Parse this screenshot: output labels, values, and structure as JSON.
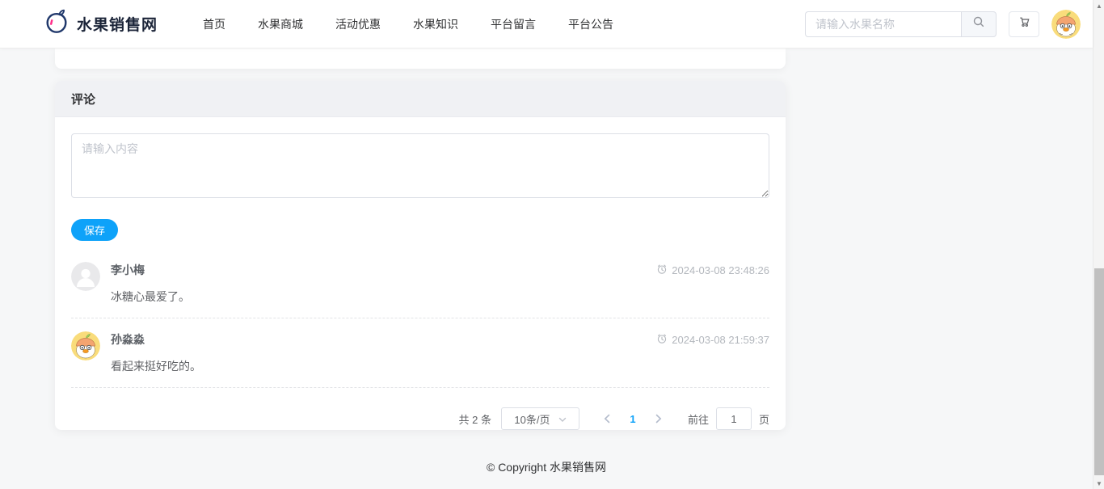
{
  "brand": {
    "name": "水果销售网"
  },
  "nav": {
    "items": [
      {
        "label": "首页"
      },
      {
        "label": "水果商城"
      },
      {
        "label": "活动优惠"
      },
      {
        "label": "水果知识"
      },
      {
        "label": "平台留言"
      },
      {
        "label": "平台公告"
      }
    ]
  },
  "search": {
    "placeholder": "请输入水果名称"
  },
  "icons": {
    "search_icon": "magnifier",
    "cart_icon": "shopping-cart",
    "time_icon": "alarm-clock",
    "select_icon": "chevron-down",
    "prev_icon": "chevron-left",
    "next_icon": "chevron-right",
    "logo_icon": "apple-outline",
    "avatar_icon": "orange-duck-cartoon",
    "default_avatar_icon": "person-silhouette",
    "scroll_up_icon": "▲",
    "scroll_down_icon": "▼"
  },
  "comments_card": {
    "title": "评论",
    "editor": {
      "placeholder": "请输入内容",
      "save_label": "保存"
    },
    "comments": [
      {
        "author": "李小梅",
        "time": "2024-03-08 23:48:26",
        "content": "冰糖心最爱了。"
      },
      {
        "author": "孙淼淼",
        "time": "2024-03-08 21:59:37",
        "content": "看起来挺好吃的。"
      }
    ],
    "pagination": {
      "total_label": "共 2 条",
      "page_size_label": "10条/页",
      "current_page": "1",
      "goto_label": "前往",
      "goto_value": "1",
      "page_unit_label": "页"
    }
  },
  "footer": {
    "copyright": "© Copyright 水果销售网"
  },
  "colors": {
    "primary": "#0ea2f9",
    "card_header_bg": "#f0f1f4",
    "page_bg": "#f6f7f8"
  }
}
